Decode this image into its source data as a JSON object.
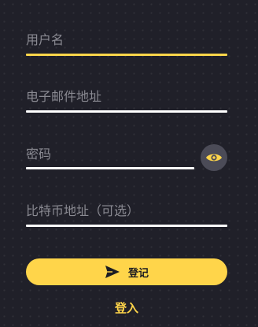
{
  "form": {
    "username_placeholder": "用户名",
    "email_placeholder": "电子邮件地址",
    "password_placeholder": "密码",
    "btc_placeholder": "比特币地址（可选）"
  },
  "actions": {
    "signup_label": "登记",
    "login_label": "登入"
  },
  "colors": {
    "accent": "#ffd54a",
    "background": "#202029",
    "underline": "#ffffff",
    "placeholder": "#8a8a92",
    "eye_button_bg": "#4b4b57"
  },
  "icons": {
    "password_toggle": "eye-icon",
    "signup": "send-icon"
  }
}
